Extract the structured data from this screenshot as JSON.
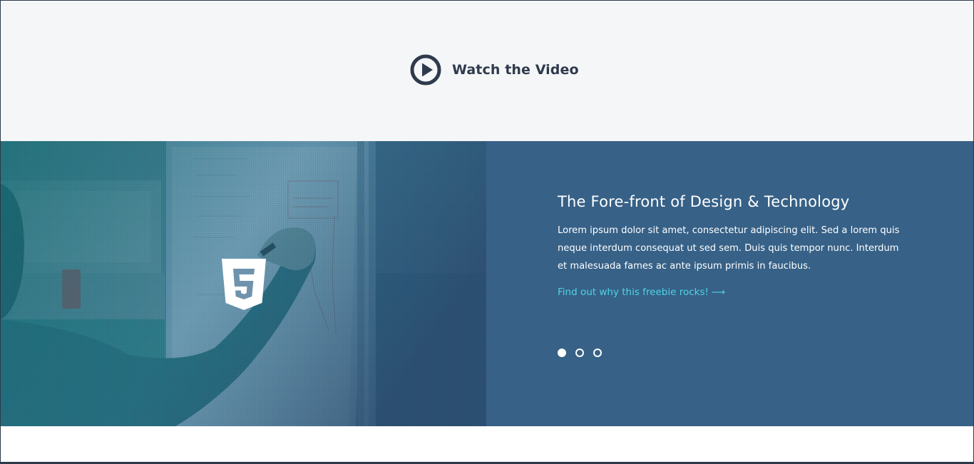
{
  "video_section": {
    "watch_label": "Watch the Video",
    "icon": "play-circle-icon"
  },
  "feature": {
    "image_badge_icon": "html5-icon",
    "title": "The Fore-front of Design & Technology",
    "body": "Lorem ipsum dolor sit amet, consectetur adipiscing elit. Sed a lorem quis neque interdum consequat ut sed sem. Duis quis tempor nunc. Interdum et malesuada fames ac ante ipsum primis in faucibus.",
    "link_label": "Find out why this freebie rocks!",
    "link_arrow": "⟶",
    "slides": [
      {
        "active": true
      },
      {
        "active": false
      },
      {
        "active": false
      }
    ]
  },
  "colors": {
    "video_bg": "#f5f6f8",
    "panel_bg": "#376187",
    "link": "#4fd3e6",
    "heading_dark": "#2f3a4c"
  }
}
